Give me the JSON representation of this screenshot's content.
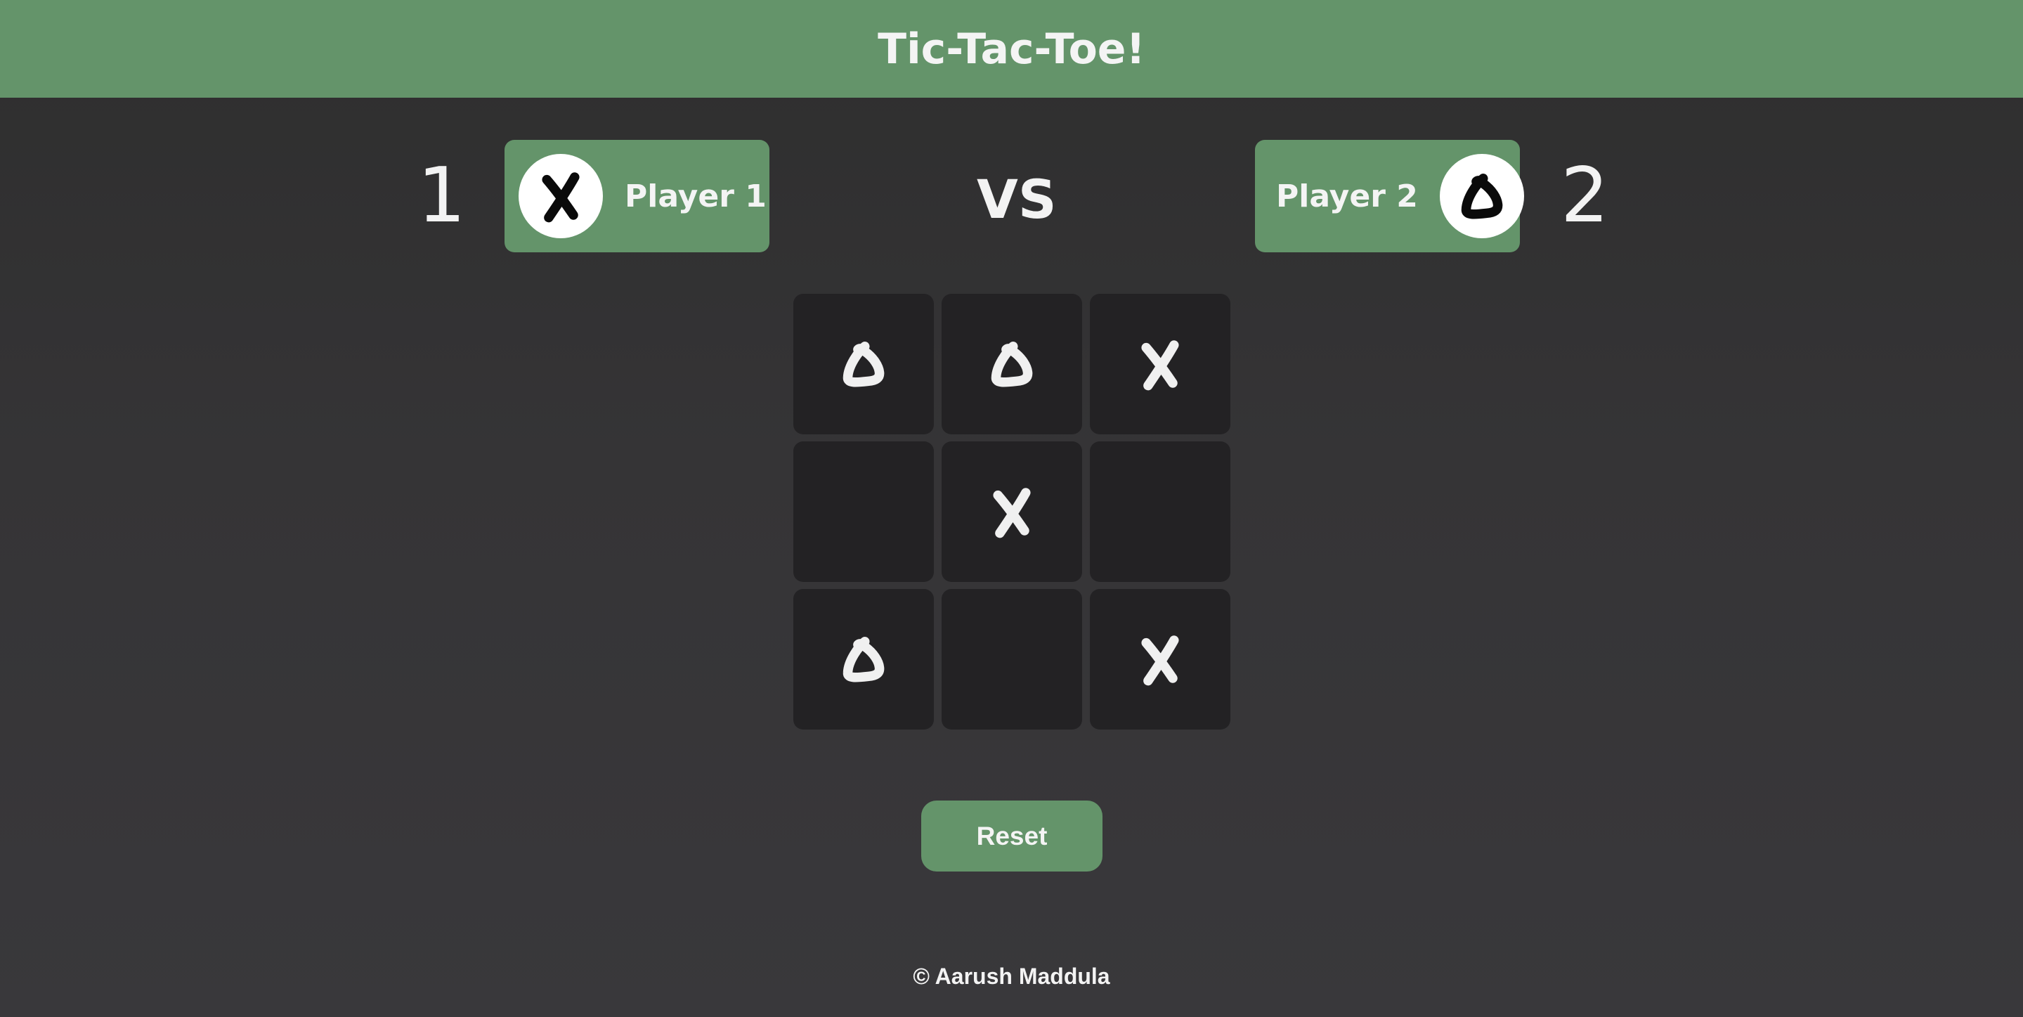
{
  "header": {
    "title": "Tic-Tac-Toe!"
  },
  "players": [
    {
      "score": "1",
      "name": "Player 1",
      "symbol": "X"
    },
    {
      "score": "2",
      "name": "Player 2",
      "symbol": "O"
    }
  ],
  "vs_label": "VS",
  "board": {
    "cells": [
      "O",
      "O",
      "X",
      "",
      "X",
      "",
      "O",
      "",
      "X"
    ]
  },
  "reset_label": "Reset",
  "footer": {
    "text": "© Aarush Maddula"
  },
  "colors": {
    "accent": "#64946a",
    "background": "#353436",
    "cell": "#232224",
    "mark_board": "#f0f0f0",
    "mark_avatar": "#0a0a0a"
  }
}
